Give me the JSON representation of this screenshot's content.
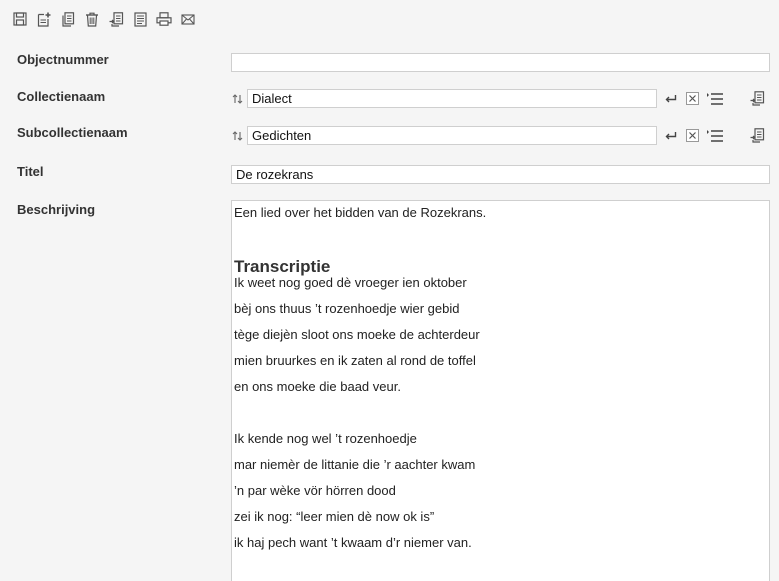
{
  "colors": {
    "background": "#f5f5f5",
    "field_border": "#cfcfcf",
    "icon": "#555555",
    "label": "#333333"
  },
  "toolbar": {
    "buttons": [
      {
        "icon": "save-icon"
      },
      {
        "icon": "new-record-icon"
      },
      {
        "icon": "copy-icon"
      },
      {
        "icon": "trash-icon"
      },
      {
        "icon": "import-icon"
      },
      {
        "icon": "notes-icon"
      },
      {
        "icon": "print-icon"
      },
      {
        "icon": "mail-icon"
      }
    ]
  },
  "fields": {
    "objectnummer": {
      "label": "Objectnummer",
      "value": ""
    },
    "collectienaam": {
      "label": "Collectienaam",
      "value": "Dialect"
    },
    "subcollectienaam": {
      "label": "Subcollectienaam",
      "value": "Gedichten"
    },
    "titel": {
      "label": "Titel",
      "value": "De rozekrans"
    },
    "beschrijving": {
      "label": "Beschrijving",
      "intro": "Een lied over het bidden van de Rozekrans.",
      "heading": "Transcriptie",
      "stanza1": [
        "Ik weet nog goed dè vroeger ien oktober",
        "bèj ons thuus ’t rozenhoedje wier gebid",
        "tège diejèn sloot ons moeke de achterdeur",
        "mien bruurkes en ik zaten al rond de toffel",
        "en ons moeke die baad veur."
      ],
      "stanza2": [
        "Ik kende nog wel ’t rozenhoedje",
        "mar niemèr de littanie die ’r aachter kwam",
        "’n par wèke vör hörren dood",
        "zei ik nog: “leer mien dè now ok is”",
        "ik haj pech want ’t kwaam d’r niemer van."
      ]
    }
  }
}
